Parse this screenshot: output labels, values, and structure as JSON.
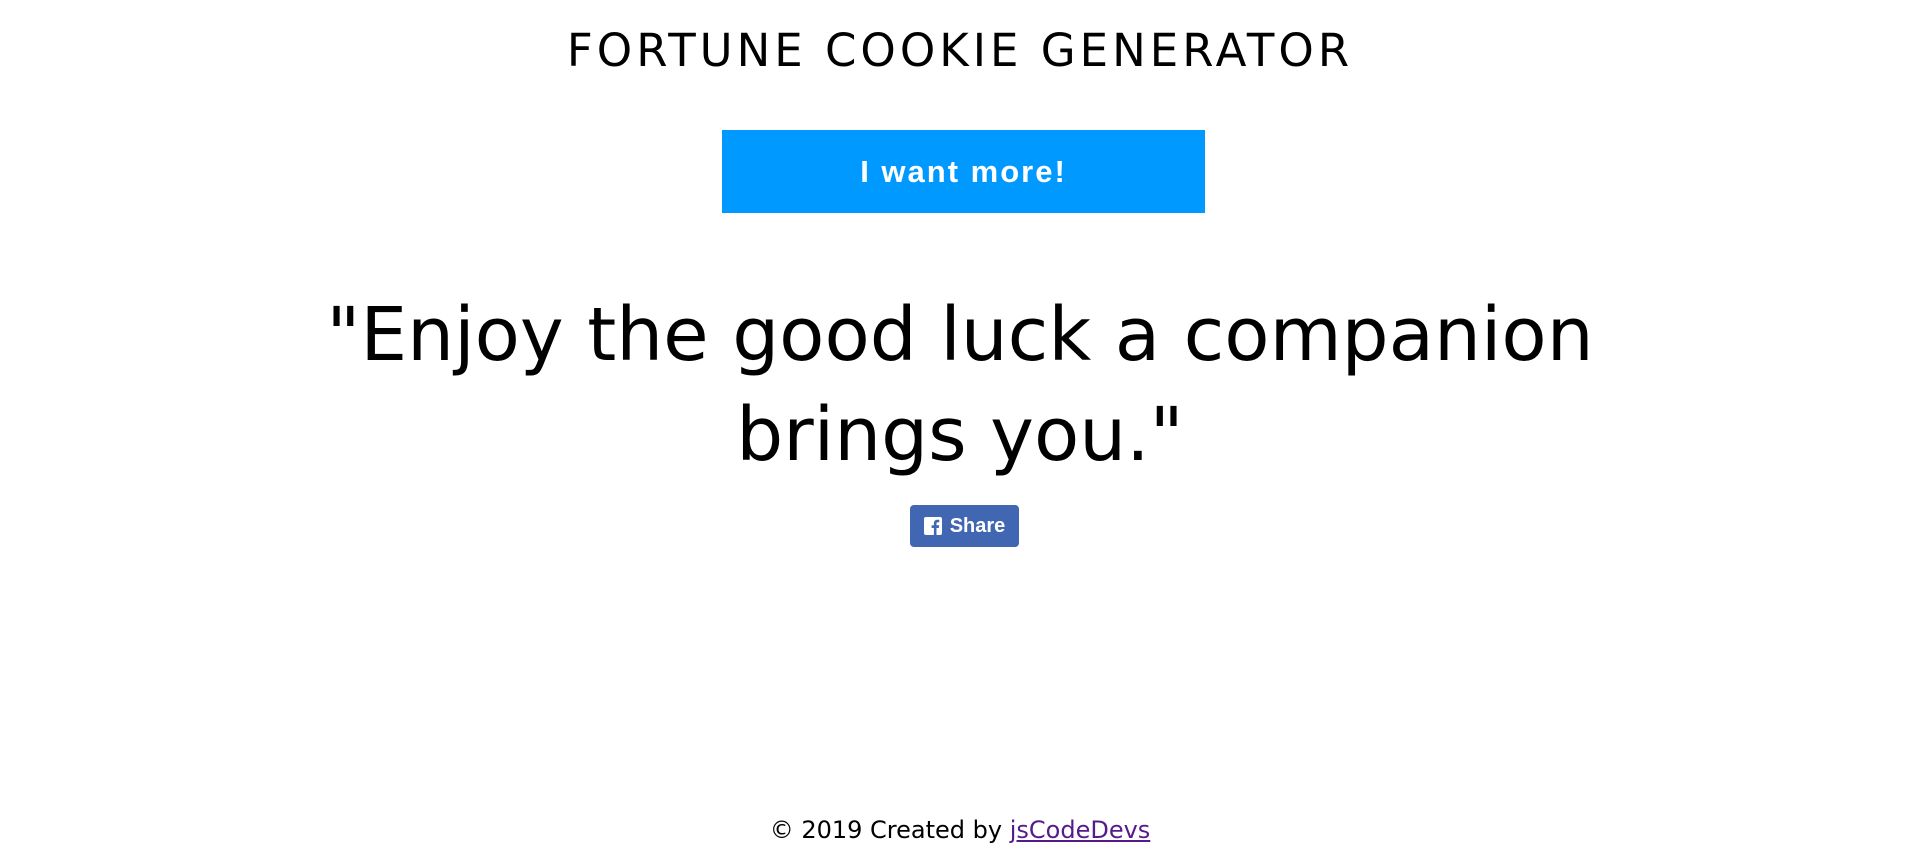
{
  "header": {
    "title": "FORTUNE COOKIE GENERATOR"
  },
  "actions": {
    "more_label": "I want more!",
    "share_label": "Share"
  },
  "fortune": {
    "quote": "\"Enjoy the good luck a companion brings you.\""
  },
  "footer": {
    "prefix": "© 2019 Created by",
    "link_text": "jsCodeDevs"
  },
  "colors": {
    "accent": "#0099ff",
    "facebook": "#4267b2",
    "link_visited": "#551a8b"
  },
  "icons": {
    "share": "facebook-icon"
  }
}
